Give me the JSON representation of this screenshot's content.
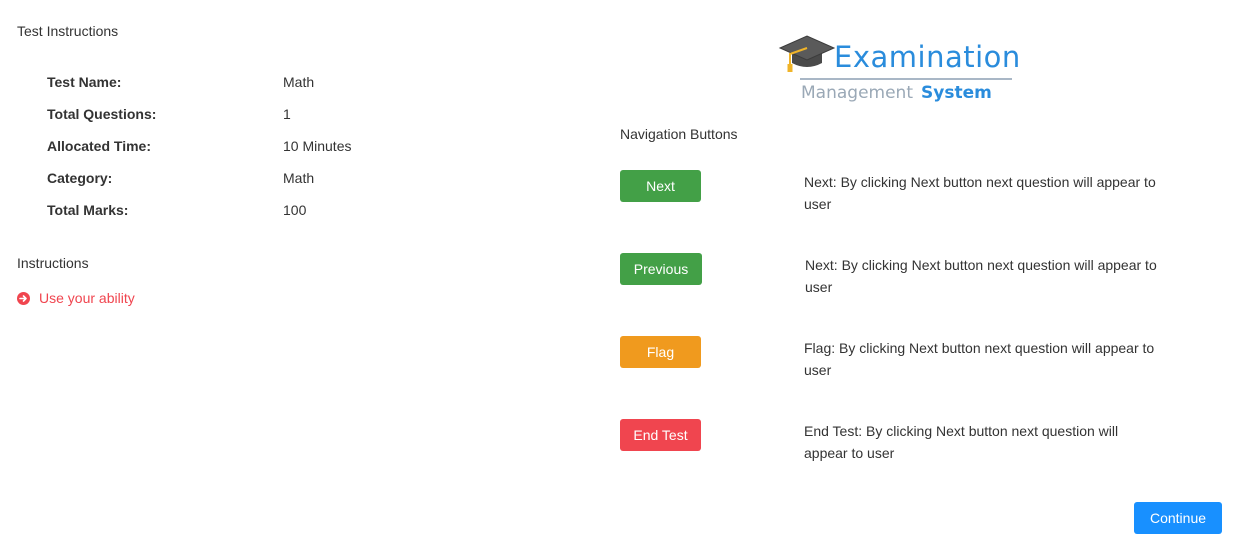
{
  "test_instructions": {
    "title": "Test Instructions",
    "rows": [
      {
        "label": "Test Name:",
        "value": "Math"
      },
      {
        "label": "Total Questions:",
        "value": "1"
      },
      {
        "label": "Allocated Time:",
        "value": "10 Minutes"
      },
      {
        "label": "Category:",
        "value": "Math"
      },
      {
        "label": "Total Marks:",
        "value": "100"
      }
    ]
  },
  "instructions": {
    "title": "Instructions",
    "items": [
      {
        "text": "Use your ability",
        "icon": "arrow-circle-right-icon"
      }
    ]
  },
  "logo": {
    "main": "Examination",
    "sub1": "Management",
    "sub2": "System"
  },
  "navigation": {
    "title": "Navigation Buttons",
    "buttons": [
      {
        "label": "Next",
        "color": "#43a047",
        "description": "Next: By clicking Next button next question will appear to user"
      },
      {
        "label": "Previous",
        "color": "#43a047",
        "description": "Next: By clicking Next button next question will appear to user"
      },
      {
        "label": "Flag",
        "color": "#f09a1e",
        "description": "Flag: By clicking Next button next question will appear to user"
      },
      {
        "label": "End Test",
        "color": "#f0454f",
        "description": "End Test: By clicking Next button next question will appear to user"
      }
    ]
  },
  "continue_button": {
    "label": "Continue",
    "color": "#1890ff"
  }
}
